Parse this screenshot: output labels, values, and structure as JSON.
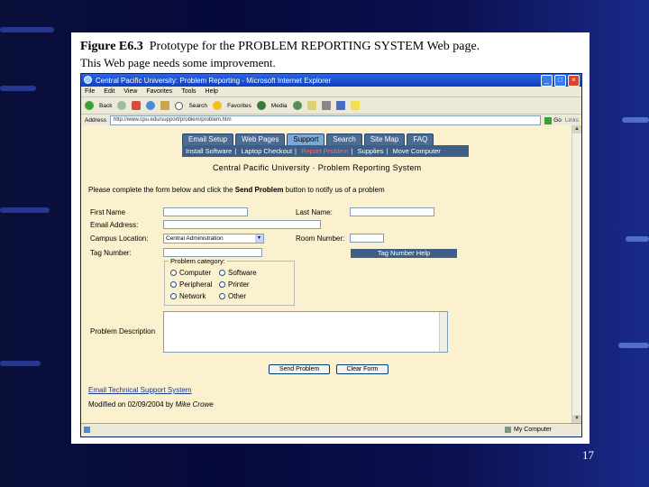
{
  "slide": {
    "figure_label": "Figure E6.3",
    "figure_caption": "Prototype for the PROBLEM REPORTING SYSTEM Web page.",
    "subtitle": "This Web page needs some improvement.",
    "page_number": "17"
  },
  "browser": {
    "window_title": "Central Pacific University: Problem Reporting - Microsoft Internet Explorer",
    "menu": [
      "File",
      "Edit",
      "View",
      "Favorites",
      "Tools",
      "Help"
    ],
    "toolbar": {
      "back": "Back",
      "search": "Search",
      "favorites": "Favorites",
      "media": "Media"
    },
    "address_label": "Address",
    "address_value": "http://www.cpu.edu/support/problem/problem.htm",
    "go_label": "Go",
    "links_label": "Links",
    "status_zone": "My Computer"
  },
  "site": {
    "nav_tabs": [
      "Email Setup",
      "Web Pages",
      "Support",
      "Search",
      "Site Map",
      "FAQ"
    ],
    "active_tab": "Support",
    "subnav": [
      "Install Software",
      "Laptop Checkout",
      "Report Problem",
      "Supplies",
      "Move Computer"
    ],
    "active_subnav": "Report Problem",
    "site_title": "Central Pacific University · Problem Reporting System"
  },
  "form": {
    "instructions_pre": "Please complete the form below and click the ",
    "instructions_bold": "Send Problem",
    "instructions_post": " button to notify us of a problem",
    "first_name_label": "First Name",
    "last_name_label": "Last Name:",
    "email_label": "Email Address:",
    "campus_label": "Campus Location:",
    "campus_value": "Central Administration",
    "room_label": "Room Number:",
    "tag_label": "Tag Number:",
    "tag_help": "Tag Number Help",
    "category_legend": "Problem category:",
    "categories": [
      "Computer",
      "Software",
      "Peripheral",
      "Printer",
      "Network",
      "Other"
    ],
    "description_label": "Problem Description",
    "send_button": "Send Problem",
    "clear_button": "Clear Form",
    "support_link": "Email Technical Support System",
    "modified_prefix": "Modified on 02/09/2004 by ",
    "modified_author": "Mike Crowe"
  }
}
